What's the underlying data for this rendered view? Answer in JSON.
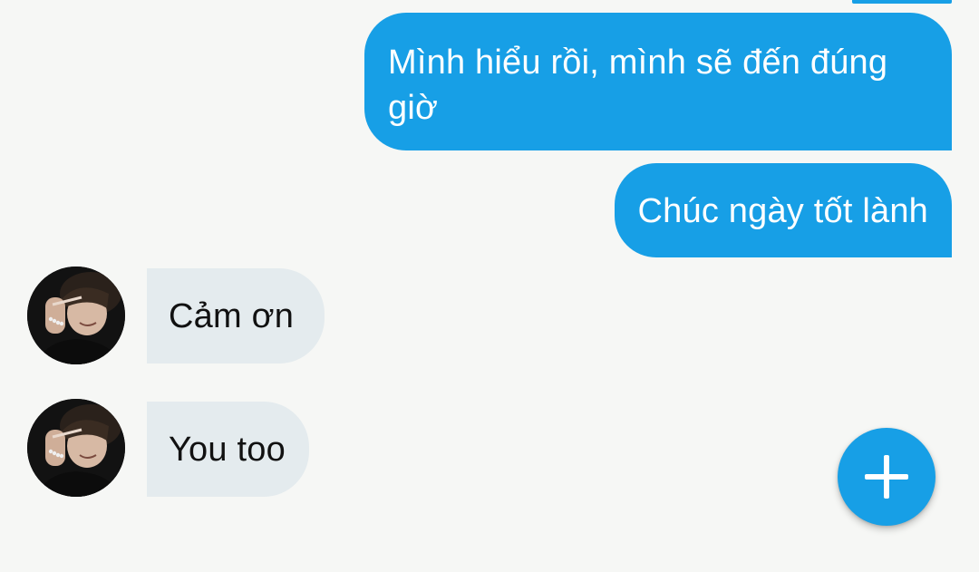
{
  "colors": {
    "outgoing_bubble": "#179fe6",
    "incoming_bubble": "#e4ebee",
    "background": "#f6f7f5",
    "fab": "#179fe6"
  },
  "messages": [
    {
      "direction": "outgoing",
      "text": "Mình hiểu rồi, mình sẽ đến đúng giờ"
    },
    {
      "direction": "outgoing",
      "text": "Chúc ngày tốt lành"
    },
    {
      "direction": "incoming",
      "text": "Cảm ơn",
      "has_avatar": true
    },
    {
      "direction": "incoming",
      "text": "You too",
      "has_avatar": true
    }
  ],
  "fab": {
    "icon": "plus-icon"
  }
}
